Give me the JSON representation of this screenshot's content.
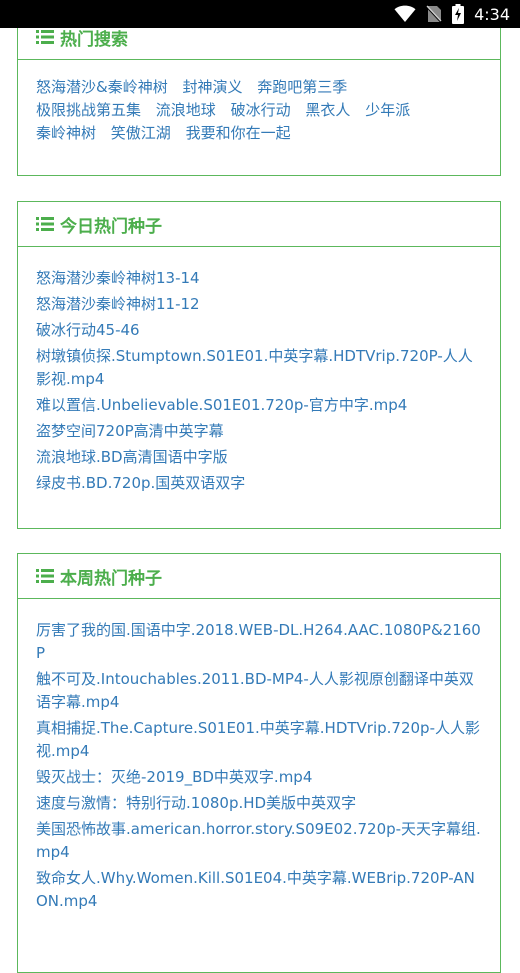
{
  "status_bar": {
    "time": "4:34"
  },
  "panels": {
    "hot_search": {
      "title": "热门搜索",
      "tags": [
        "怒海潜沙&秦岭神树",
        "封神演义",
        "奔跑吧第三季",
        "极限挑战第五集",
        "流浪地球",
        "破冰行动",
        "黑衣人",
        "少年派",
        "秦岭神树",
        "笑傲江湖",
        "我要和你在一起"
      ]
    },
    "today_hot": {
      "title": "今日热门种子",
      "items": [
        "怒海潜沙秦岭神树13-14",
        "怒海潜沙秦岭神树11-12",
        "破冰行动45-46",
        "树墩镇侦探.Stumptown.S01E01.中英字幕.HDTVrip.720P-人人影视.mp4",
        "难以置信.Unbelievable.S01E01.720p-官方中字.mp4",
        "盗梦空间720P高清中英字幕",
        "流浪地球.BD高清国语中字版",
        "绿皮书.BD.720p.国英双语双字"
      ]
    },
    "week_hot": {
      "title": "本周热门种子",
      "items": [
        "厉害了我的国.国语中字.2018.WEB-DL.H264.AAC.1080P&2160P",
        "触不可及.Intouchables.2011.BD-MP4-人人影视原创翻译中英双语字幕.mp4",
        "真相捕捉.The.Capture.S01E01.中英字幕.HDTVrip.720p-人人影视.mp4",
        "毁灭战士：灭绝-2019_BD中英双字.mp4",
        "速度与激情：特别行动.1080p.HD美版中英双字",
        "美国恐怖故事.american.horror.story.S09E02.720p-天天字幕组.mp4",
        "致命女人.Why.Women.Kill.S01E04.中英字幕.WEBrip.720P-ANON.mp4"
      ]
    }
  }
}
